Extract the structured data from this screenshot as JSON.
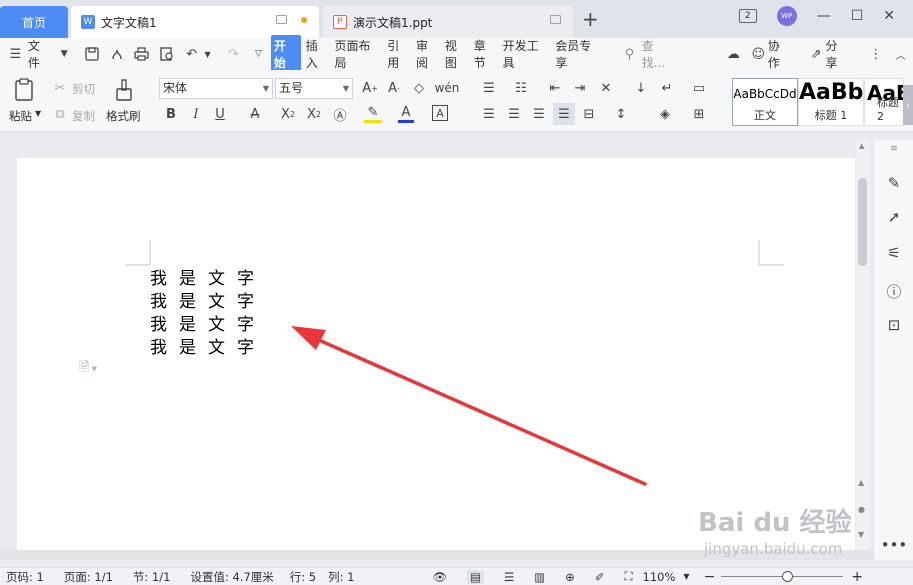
{
  "tabs": {
    "home": "首页",
    "doc": "文字文稿1",
    "ppt": "演示文稿1.ppt"
  },
  "window": {
    "window_count": "2",
    "avatar": "WP"
  },
  "menu": {
    "file": "文件",
    "items": [
      "开始",
      "插入",
      "页面布局",
      "引用",
      "审阅",
      "视图",
      "章节",
      "开发工具",
      "会员专享"
    ],
    "search": "查找...",
    "collab": "协作",
    "share": "分享"
  },
  "ribbon": {
    "paste": "粘贴",
    "cut": "剪切",
    "copy": "复制",
    "format_painter": "格式刷",
    "font": "宋体",
    "size": "五号"
  },
  "styles": [
    {
      "sample": "AaBbCcDd",
      "name": "正文"
    },
    {
      "sample": "AaBb",
      "name": "标题 1"
    },
    {
      "sample": "AaBb",
      "name": "标题 2"
    }
  ],
  "document": {
    "lines": [
      "我是文字",
      "我是文字",
      "我是文字",
      "我是文字"
    ]
  },
  "status": {
    "page_num": "页码: 1",
    "pages": "页面: 1/1",
    "section": "节: 1/1",
    "setting": "设置值: 4.7厘米",
    "row": "行: 5",
    "col": "列: 1",
    "zoom": "110%",
    "zoom_level": 0.55
  },
  "watermark": {
    "top": "Bai du 经验",
    "bottom": "jingyan.baidu.com"
  },
  "colors": {
    "accent": "#4d8bf5",
    "arrow": "#e8363a"
  }
}
